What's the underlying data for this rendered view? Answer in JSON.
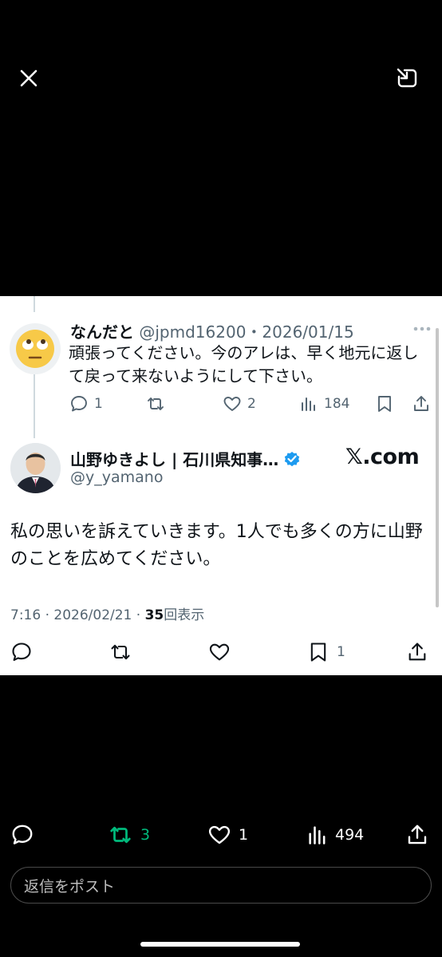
{
  "reply_tweet": {
    "name": "なんだと",
    "handle_date": "@jpmd16200・2026/01/15",
    "text": "頑張ってください。今のアレは、早く地元に返して戻って来ないようにして下さい。",
    "avatar_emoji": "🙄",
    "actions": {
      "replies": "1",
      "likes": "2",
      "views": "184"
    }
  },
  "main_tweet": {
    "name": "山野ゆきよし | 石川県知事…",
    "handle": "@y_yamano",
    "source": "𝕏.com",
    "text": "私の思いを訴えていきます。1人でも多くの方に山野のことを広めてください。",
    "time": "7:16 · 2026/02/21 · ",
    "views_count": "35",
    "views_label": "回表示",
    "actions": {
      "bookmarks": "1"
    }
  },
  "bottom_bar": {
    "retweets": "3",
    "likes": "1",
    "views": "494"
  },
  "reply_box": {
    "placeholder": "返信をポスト"
  },
  "colors": {
    "retweet_green": "#00ba7c",
    "verified_blue": "#1d9bf0",
    "muted": "#536471"
  }
}
